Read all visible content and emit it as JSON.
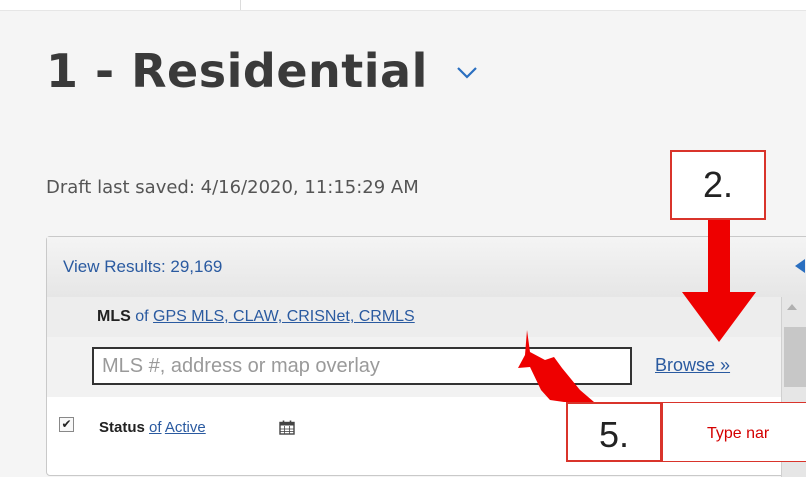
{
  "page": {
    "title": "1 - Residential",
    "draft_saved": "Draft last saved: 4/16/2020, 11:15:29 AM"
  },
  "results": {
    "label": "View Results: 29,169"
  },
  "mls": {
    "label": "MLS",
    "of": "of",
    "sources": "GPS MLS, CLAW, CRISNet, CRMLS"
  },
  "search": {
    "placeholder": "MLS #, address or map overlay",
    "value": "",
    "browse_label": "Browse »"
  },
  "status": {
    "label": "Status",
    "of": "of",
    "value": "Active",
    "checked": true
  },
  "annotations": {
    "step_2": "2.",
    "step_5": "5.",
    "type_note": "Type nar"
  },
  "colors": {
    "link": "#2a5aa0",
    "annotation_red": "#ee0000",
    "callout_border": "#d9342b"
  },
  "icons": {
    "title_dropdown": "chevron-down-icon",
    "collapse": "triangle-left-icon",
    "calendar": "calendar-icon",
    "checkbox": "checkmark-icon"
  }
}
